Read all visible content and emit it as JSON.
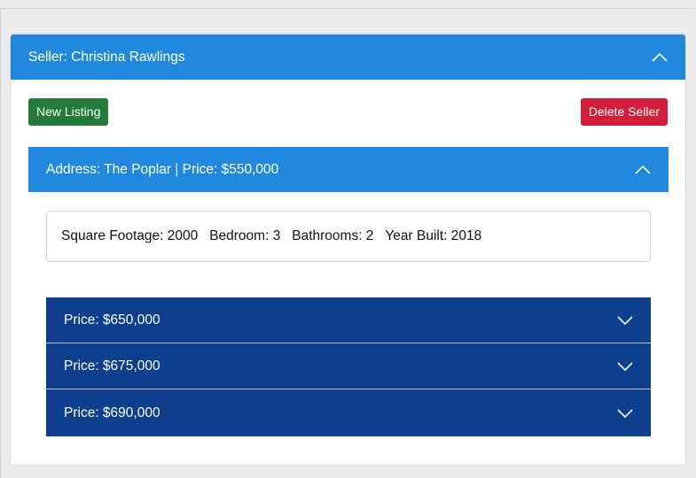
{
  "seller": {
    "header_label": "Seller: Christina Rawlings",
    "collapse_icon": "chevron-up-icon"
  },
  "actions": {
    "new_listing_label": "New Listing",
    "new_listing_color": "#237a3b",
    "delete_seller_label": "Delete Seller",
    "delete_seller_color": "#d41d3a"
  },
  "listing": {
    "header_label": "Address: The Poplar | Price: $550,000",
    "collapse_icon": "chevron-up-icon",
    "details": {
      "square_footage": "Square Footage: 2000",
      "bedroom": "Bedroom: 3",
      "bathrooms": "Bathrooms: 2",
      "year_built": "Year Built: 2018"
    }
  },
  "offers": [
    {
      "label": "Price: $650,000",
      "icon": "chevron-down-icon"
    },
    {
      "label": "Price: $675,000",
      "icon": "chevron-down-icon"
    },
    {
      "label": "Price: $690,000",
      "icon": "chevron-down-icon"
    }
  ],
  "colors": {
    "accordion_blue": "#2189dd",
    "offer_navy": "#0d3f8c"
  }
}
